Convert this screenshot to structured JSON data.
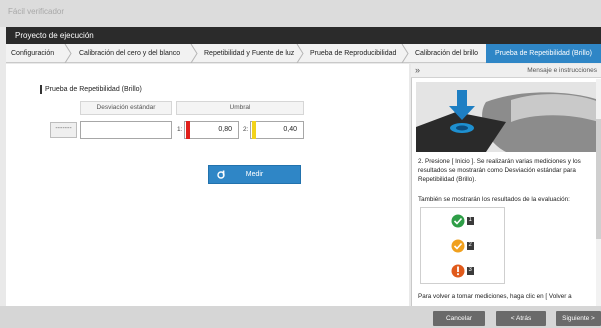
{
  "window": {
    "title": "Fácil verificador"
  },
  "project": {
    "title": "Proyecto de ejecución"
  },
  "tabs": [
    "Configuración",
    "Calibración del cero y del blanco",
    "Repetibilidad y Fuente de luz",
    "Prueba de Reproducibilidad",
    "Calibración del brillo",
    "Prueba de Repetibilidad (Brillo)"
  ],
  "section": {
    "title": "Prueba de Repetibilidad (Brillo)",
    "col_std": "Desviación estándar",
    "col_threshold": "Umbral",
    "dash_button": "-------",
    "std_value": "",
    "label1": "1:",
    "label2": "2:",
    "threshold1": "0,80",
    "threshold2": "0,40",
    "measure_button": "Medir"
  },
  "panel": {
    "collapse": "»",
    "title": "Mensaje e instrucciones",
    "step2": "2. Presione [ Inicio ]. Se realizarán varias mediciones y los resultados se mostrarán como Desviación estándar para Repetibilidad (Brillo).",
    "eval_text": "También se mostrarán los resultados de la evaluación:",
    "eval_items": [
      "1",
      "2",
      "3"
    ],
    "footer_text": "Para volver a tomar mediciones, haga clic en [ Volver a"
  },
  "footer": {
    "cancel": "Cancelar",
    "back": "< Atrás",
    "next": "Siguiente >"
  },
  "colors": {
    "accent": "#2f86c6",
    "red_marker": "#e0201b",
    "yellow_marker": "#f2d21a",
    "pass": "#2e9e47",
    "warn": "#f0a01e",
    "fail": "#e05a1b"
  }
}
